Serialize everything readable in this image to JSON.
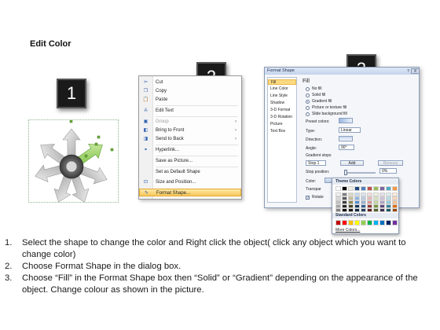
{
  "title": "Edit Color",
  "badges": [
    "1",
    "2",
    "3"
  ],
  "context_menu": {
    "items": [
      {
        "label": "Cut",
        "icon": "scissors-icon",
        "glyph": "✂"
      },
      {
        "label": "Copy",
        "icon": "copy-icon",
        "glyph": "❐"
      },
      {
        "label": "Paste",
        "icon": "paste-icon",
        "glyph": "📋"
      },
      {
        "label": "Edit Text",
        "icon": "edit-text-icon",
        "glyph": "A"
      },
      {
        "label": "Group",
        "icon": "group-icon",
        "glyph": "▣",
        "submenu": true,
        "disabled": true
      },
      {
        "label": "Bring to Front",
        "icon": "bring-front-icon",
        "glyph": "◧",
        "submenu": true
      },
      {
        "label": "Send to Back",
        "icon": "send-back-icon",
        "glyph": "◨",
        "submenu": true
      },
      {
        "label": "Hyperlink...",
        "icon": "hyperlink-icon",
        "glyph": "⚭"
      },
      {
        "label": "Save as Picture...",
        "icon": "",
        "glyph": ""
      },
      {
        "label": "Set as Default Shape",
        "icon": "",
        "glyph": ""
      },
      {
        "label": "Size and Position...",
        "icon": "size-position-icon",
        "glyph": "⊡"
      },
      {
        "label": "Format Shape...",
        "icon": "format-shape-icon",
        "glyph": "✎",
        "highlight": true
      }
    ]
  },
  "format_dialog": {
    "title": "Format Shape",
    "help": "?",
    "close": "X",
    "nav": [
      "Fill",
      "Line Color",
      "Line Style",
      "Shadow",
      "3-D Format",
      "3-D Rotation",
      "Picture",
      "Text Box"
    ],
    "selected_nav": "Fill",
    "section_title": "Fill",
    "options": [
      "No fill",
      "Solid fill",
      "Gradient fill",
      "Picture or texture fill",
      "Slide background fill"
    ],
    "selected_option": "Gradient fill",
    "preset_colors_label": "Preset colors:",
    "type_label": "Type:",
    "type_value": "Linear",
    "direction_label": "Direction:",
    "angle_label": "Angle:",
    "angle_value": "90°",
    "gradient_stops_label": "Gradient stops",
    "stop_value": "Stop 1",
    "add_label": "Add",
    "remove_label": "Remove",
    "stop_position_label": "Stop position:",
    "stop_position_value": "0%",
    "color_label": "Color:",
    "transparency_label": "Transpar",
    "rotate_label": "Rotate"
  },
  "palette": {
    "theme_label": "Theme Colors",
    "standard_label": "Standard Colors",
    "more_label": "More Colors...",
    "theme_top": [
      "#ffffff",
      "#000000",
      "#eeece1",
      "#1f497d",
      "#4f81bd",
      "#c0504d",
      "#9bbb59",
      "#8064a2",
      "#4bacc6",
      "#f79646"
    ],
    "theme_rows": [
      [
        "#f2f2f2",
        "#7f7f7f",
        "#ddd9c3",
        "#c6d9f0",
        "#dbe5f1",
        "#f2dcdb",
        "#ebf1dd",
        "#e5e0ec",
        "#dbeef3",
        "#fdeada"
      ],
      [
        "#d8d8d8",
        "#595959",
        "#c4bd97",
        "#8db3e2",
        "#b8cce4",
        "#e5b9b7",
        "#d7e3bc",
        "#ccc1d9",
        "#b7dde8",
        "#fbd5b5"
      ],
      [
        "#bfbfbf",
        "#3f3f3f",
        "#938953",
        "#548dd4",
        "#95b3d7",
        "#d99694",
        "#c3d69b",
        "#b2a2c7",
        "#92cddc",
        "#fac08f"
      ],
      [
        "#a5a5a5",
        "#262626",
        "#494429",
        "#17365d",
        "#366092",
        "#953734",
        "#76923c",
        "#5f497a",
        "#31859b",
        "#e36c09"
      ],
      [
        "#7f7f7f",
        "#0c0c0c",
        "#1d1b10",
        "#0f243e",
        "#244061",
        "#632423",
        "#4f6128",
        "#3f3151",
        "#205867",
        "#974806"
      ]
    ],
    "standard": [
      "#c00000",
      "#ff0000",
      "#ffc000",
      "#ffff00",
      "#92d050",
      "#00b050",
      "#00b0f0",
      "#0070c0",
      "#002060",
      "#7030a0"
    ]
  },
  "steps": [
    {
      "num": "1.",
      "text": "Select the shape to change the color and Right click the object( click any object which you want to change color)"
    },
    {
      "num": "2.",
      "text": "Choose Format Shape in the dialog box."
    },
    {
      "num": "3.",
      "text": "Choose “Fill” in the Format Shape box then “Solid” or “Gradient” depending on the appearance of the object. Change colour as shown in the picture."
    }
  ]
}
